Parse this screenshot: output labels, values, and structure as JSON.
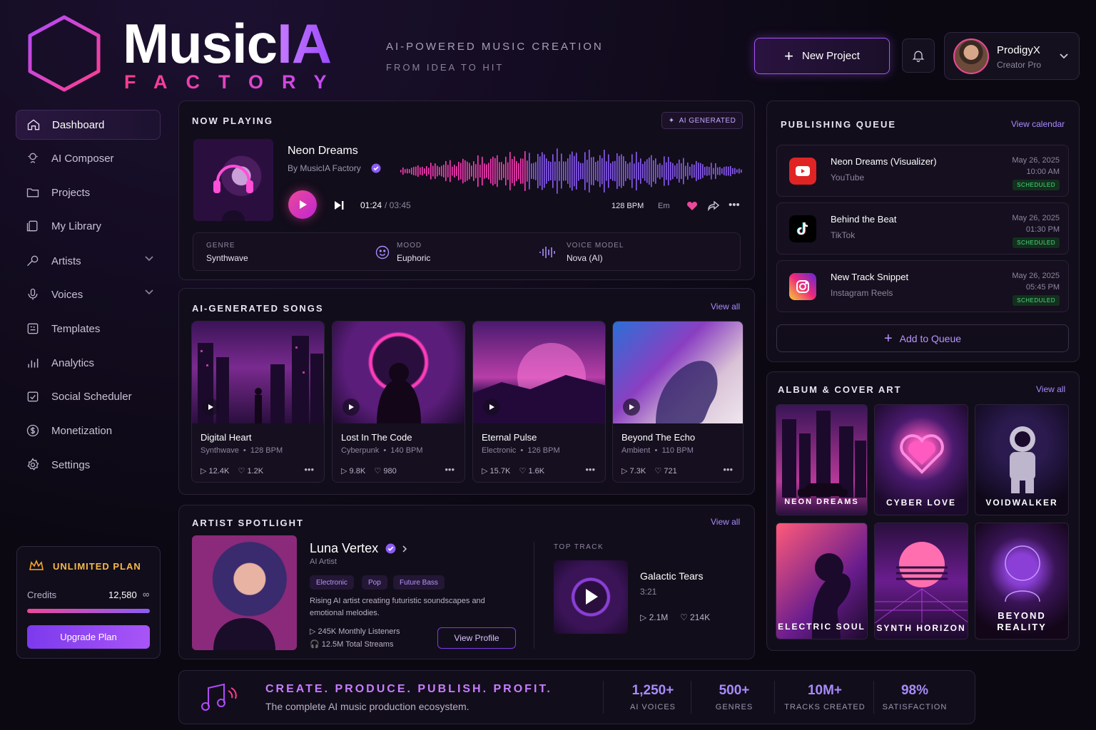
{
  "brand": {
    "name_a": "Music",
    "name_b": "IA",
    "sub": "FACTORY",
    "tagline1": "AI-POWERED MUSIC CREATION",
    "tagline2": "FROM IDEA TO HIT"
  },
  "header": {
    "new_project": "New Project",
    "user_name": "ProdigyX",
    "user_role": "Creator Pro"
  },
  "sidebar": {
    "items": [
      {
        "label": "Dashboard",
        "icon": "home-icon"
      },
      {
        "label": "AI Composer",
        "icon": "composer-icon"
      },
      {
        "label": "Projects",
        "icon": "folder-icon"
      },
      {
        "label": "My Library",
        "icon": "library-icon"
      },
      {
        "label": "Artists",
        "icon": "mic-icon"
      },
      {
        "label": "Voices",
        "icon": "microphone-icon"
      },
      {
        "label": "Templates",
        "icon": "templates-icon"
      },
      {
        "label": "Analytics",
        "icon": "analytics-icon"
      },
      {
        "label": "Social Scheduler",
        "icon": "calendar-icon"
      },
      {
        "label": "Monetization",
        "icon": "dollar-icon"
      },
      {
        "label": "Settings",
        "icon": "gear-icon"
      }
    ],
    "plan": {
      "title": "UNLIMITED PLAN",
      "credits_label": "Credits",
      "credits_value": "12,580",
      "infinity": "∞",
      "upgrade": "Upgrade Plan"
    }
  },
  "now_playing": {
    "title": "NOW PLAYING",
    "badge": "AI GENERATED",
    "track": "Neon Dreams",
    "by": "By MusicIA Factory",
    "elapsed": "01:24",
    "total": "/ 03:45",
    "bpm": "128 BPM",
    "key": "Em",
    "genre_lbl": "GENRE",
    "genre": "Synthwave",
    "mood_lbl": "MOOD",
    "mood": "Euphoric",
    "voice_lbl": "VOICE MODEL",
    "voice": "Nova (AI)"
  },
  "songs": {
    "title": "AI-GENERATED SONGS",
    "view_all": "View all",
    "items": [
      {
        "title": "Digital Heart",
        "genre": "Synthwave",
        "bpm": "128 BPM",
        "plays": "12.4K",
        "likes": "1.2K"
      },
      {
        "title": "Lost In The Code",
        "genre": "Cyberpunk",
        "bpm": "140 BPM",
        "plays": "9.8K",
        "likes": "980"
      },
      {
        "title": "Eternal Pulse",
        "genre": "Electronic",
        "bpm": "126 BPM",
        "plays": "15.7K",
        "likes": "1.6K"
      },
      {
        "title": "Beyond The Echo",
        "genre": "Ambient",
        "bpm": "110 BPM",
        "plays": "7.3K",
        "likes": "721"
      }
    ]
  },
  "artist": {
    "title": "ARTIST SPOTLIGHT",
    "view_all": "View all",
    "name": "Luna Vertex",
    "type": "AI Artist",
    "tags": [
      "Electronic",
      "Pop",
      "Future Bass"
    ],
    "bio": "Rising AI artist creating futuristic soundscapes and emotional melodies.",
    "listeners": "245K Monthly Listeners",
    "streams": "12.5M Total Streams",
    "view_profile": "View Profile",
    "top_label": "TOP TRACK",
    "top_track": "Galactic Tears",
    "top_len": "3:21",
    "top_plays": "2.1M",
    "top_likes": "214K"
  },
  "queue": {
    "title": "PUBLISHING QUEUE",
    "view_calendar": "View calendar",
    "add": "Add to Queue",
    "items": [
      {
        "name": "Neon Dreams (Visualizer)",
        "platform": "YouTube",
        "date": "May 26, 2025",
        "time": "10:00 AM",
        "status": "SCHEDULED"
      },
      {
        "name": "Behind the Beat",
        "platform": "TikTok",
        "date": "May 26, 2025",
        "time": "01:30 PM",
        "status": "SCHEDULED"
      },
      {
        "name": "New Track Snippet",
        "platform": "Instagram Reels",
        "date": "May 26, 2025",
        "time": "05:45 PM",
        "status": "SCHEDULED"
      }
    ]
  },
  "album": {
    "title": "ALBUM & COVER ART",
    "view_all": "View all",
    "items": [
      "NEON DREAMS",
      "CYBER LOVE",
      "VOIDWALKER",
      "ELECTRIC SOUL",
      "SYNTH HORIZON",
      "BEYOND",
      "REALITY"
    ]
  },
  "footer": {
    "headline": "CREATE. PRODUCE. PUBLISH. PROFIT.",
    "sub": "The complete AI music production ecosystem.",
    "stats": [
      {
        "v": "1,250+",
        "l": "AI VOICES"
      },
      {
        "v": "500+",
        "l": "GENRES"
      },
      {
        "v": "10M+",
        "l": "TRACKS CREATED"
      },
      {
        "v": "98%",
        "l": "SATISFACTION"
      }
    ]
  },
  "colors": {
    "accent": "#a855f7",
    "pink": "#ec4899",
    "bg": "#0b0812",
    "panel": "#120d1b"
  },
  "progress": {
    "track_fraction": 0.373,
    "credits_fraction": 1.0
  }
}
